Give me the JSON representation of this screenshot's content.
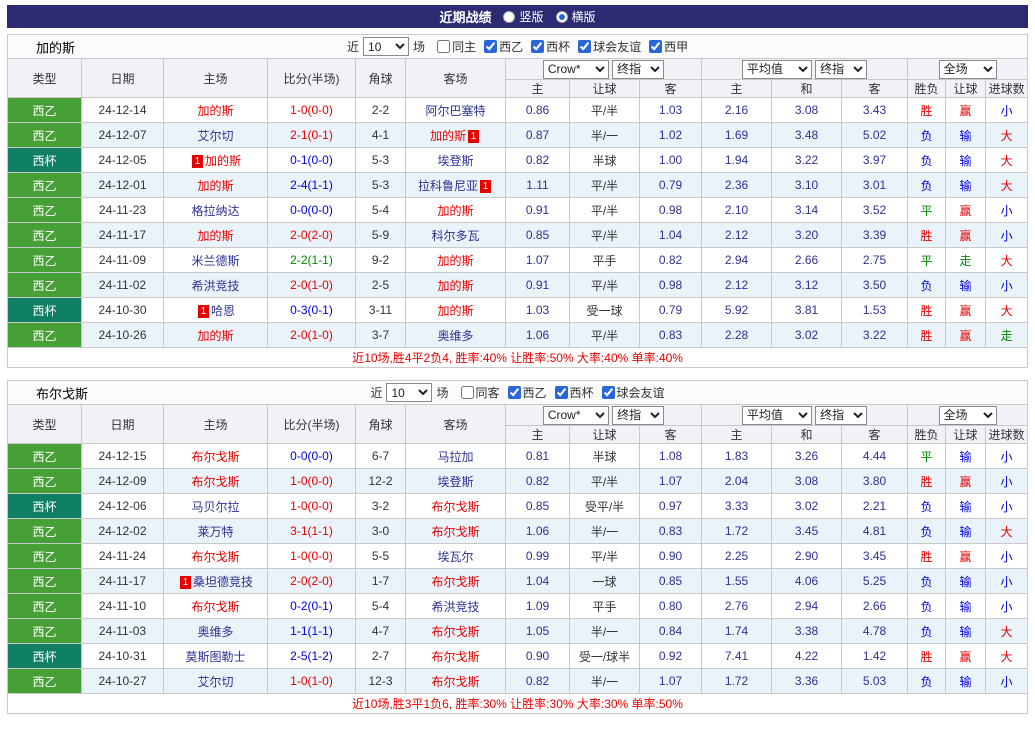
{
  "topbar": {
    "title": "近期战绩",
    "radios": [
      {
        "label": "竖版",
        "selected": false
      },
      {
        "label": "横版",
        "selected": true
      }
    ]
  },
  "table_header": {
    "left_cols": [
      "类型",
      "日期",
      "主场",
      "比分(半场)",
      "角球",
      "客场"
    ],
    "sub_cols": [
      "主",
      "让球",
      "客",
      "主",
      "和",
      "客",
      "胜负",
      "让球",
      "进球数"
    ],
    "select_odds_source": "Crow*",
    "select_final1": "终指",
    "select_avg": "平均值",
    "select_final2": "终指",
    "select_scope": "全场"
  },
  "colors": {
    "topbar_bg": "#2b2a72",
    "league_west2_green": "#47a035",
    "league_cup_teal": "#0e7f63",
    "tracked_team_red": "#e60000",
    "win_red": "#e60000",
    "loss_blue": "#0000dd",
    "push_green": "#008800",
    "alt_row_blue": "#eaf2fa"
  },
  "sections": [
    {
      "team": "加的斯",
      "filter_prefix": "近",
      "filter_count": "10",
      "filter_suffix": "场",
      "checkboxes": [
        {
          "label": "同主",
          "checked": false
        },
        {
          "label": "西乙",
          "checked": true
        },
        {
          "label": "西杯",
          "checked": true
        },
        {
          "label": "球会友谊",
          "checked": true
        },
        {
          "label": "西甲",
          "checked": true
        }
      ],
      "rows": [
        {
          "league": "西乙",
          "league_color": "green",
          "date": "24-12-14",
          "home": "加的斯",
          "home_tracked": true,
          "home_badge": "",
          "score": "1-0(0-0)",
          "score_color": "red",
          "corners": "2-2",
          "away": "阿尔巴塞特",
          "away_tracked": false,
          "away_badge": "",
          "o1": [
            "0.86",
            "平/半",
            "1.03"
          ],
          "o2": [
            "2.16",
            "3.08",
            "3.43"
          ],
          "r": [
            [
              "胜",
              "red"
            ],
            [
              "赢",
              "red"
            ],
            [
              "小",
              "blue"
            ]
          ]
        },
        {
          "league": "西乙",
          "league_color": "green",
          "date": "24-12-07",
          "home": "艾尔切",
          "home_tracked": false,
          "home_badge": "",
          "score": "2-1(0-1)",
          "score_color": "red",
          "corners": "4-1",
          "away": "加的斯",
          "away_tracked": true,
          "away_badge": "1",
          "o1": [
            "0.87",
            "半/一",
            "1.02"
          ],
          "o2": [
            "1.69",
            "3.48",
            "5.02"
          ],
          "r": [
            [
              "负",
              "blue"
            ],
            [
              "输",
              "blue"
            ],
            [
              "大",
              "red"
            ]
          ]
        },
        {
          "league": "西杯",
          "league_color": "teal",
          "date": "24-12-05",
          "home": "加的斯",
          "home_tracked": true,
          "home_badge": "1",
          "score": "0-1(0-0)",
          "score_color": "blue",
          "corners": "5-3",
          "away": "埃登斯",
          "away_tracked": false,
          "away_badge": "",
          "o1": [
            "0.82",
            "半球",
            "1.00"
          ],
          "o2": [
            "1.94",
            "3.22",
            "3.97"
          ],
          "r": [
            [
              "负",
              "blue"
            ],
            [
              "输",
              "blue"
            ],
            [
              "大",
              "red"
            ]
          ]
        },
        {
          "league": "西乙",
          "league_color": "green",
          "date": "24-12-01",
          "home": "加的斯",
          "home_tracked": true,
          "home_badge": "",
          "score": "2-4(1-1)",
          "score_color": "blue",
          "corners": "5-3",
          "away": "拉科鲁尼亚",
          "away_tracked": false,
          "away_badge": "1",
          "o1": [
            "1.11",
            "平/半",
            "0.79"
          ],
          "o2": [
            "2.36",
            "3.10",
            "3.01"
          ],
          "r": [
            [
              "负",
              "blue"
            ],
            [
              "输",
              "blue"
            ],
            [
              "大",
              "red"
            ]
          ]
        },
        {
          "league": "西乙",
          "league_color": "green",
          "date": "24-11-23",
          "home": "格拉纳达",
          "home_tracked": false,
          "home_badge": "",
          "score": "0-0(0-0)",
          "score_color": "blue",
          "corners": "5-4",
          "away": "加的斯",
          "away_tracked": true,
          "away_badge": "",
          "o1": [
            "0.91",
            "平/半",
            "0.98"
          ],
          "o2": [
            "2.10",
            "3.14",
            "3.52"
          ],
          "r": [
            [
              "平",
              "green"
            ],
            [
              "赢",
              "red"
            ],
            [
              "小",
              "blue"
            ]
          ]
        },
        {
          "league": "西乙",
          "league_color": "green",
          "date": "24-11-17",
          "home": "加的斯",
          "home_tracked": true,
          "home_badge": "",
          "score": "2-0(2-0)",
          "score_color": "red",
          "corners": "5-9",
          "away": "科尔多瓦",
          "away_tracked": false,
          "away_badge": "",
          "o1": [
            "0.85",
            "平/半",
            "1.04"
          ],
          "o2": [
            "2.12",
            "3.20",
            "3.39"
          ],
          "r": [
            [
              "胜",
              "red"
            ],
            [
              "赢",
              "red"
            ],
            [
              "小",
              "blue"
            ]
          ]
        },
        {
          "league": "西乙",
          "league_color": "green",
          "date": "24-11-09",
          "home": "米兰德斯",
          "home_tracked": false,
          "home_badge": "",
          "score": "2-2(1-1)",
          "score_color": "green",
          "corners": "9-2",
          "away": "加的斯",
          "away_tracked": true,
          "away_badge": "",
          "o1": [
            "1.07",
            "平手",
            "0.82"
          ],
          "o2": [
            "2.94",
            "2.66",
            "2.75"
          ],
          "r": [
            [
              "平",
              "green"
            ],
            [
              "走",
              "green"
            ],
            [
              "大",
              "red"
            ]
          ]
        },
        {
          "league": "西乙",
          "league_color": "green",
          "date": "24-11-02",
          "home": "希洪竞技",
          "home_tracked": false,
          "home_badge": "",
          "score": "2-0(1-0)",
          "score_color": "red",
          "corners": "2-5",
          "away": "加的斯",
          "away_tracked": true,
          "away_badge": "",
          "o1": [
            "0.91",
            "平/半",
            "0.98"
          ],
          "o2": [
            "2.12",
            "3.12",
            "3.50"
          ],
          "r": [
            [
              "负",
              "blue"
            ],
            [
              "输",
              "blue"
            ],
            [
              "小",
              "blue"
            ]
          ]
        },
        {
          "league": "西杯",
          "league_color": "teal",
          "date": "24-10-30",
          "home": "哈恩",
          "home_tracked": false,
          "home_badge": "1",
          "score": "0-3(0-1)",
          "score_color": "blue",
          "corners": "3-11",
          "away": "加的斯",
          "away_tracked": true,
          "away_badge": "",
          "o1": [
            "1.03",
            "受一球",
            "0.79"
          ],
          "o2": [
            "5.92",
            "3.81",
            "1.53"
          ],
          "r": [
            [
              "胜",
              "red"
            ],
            [
              "赢",
              "red"
            ],
            [
              "大",
              "red"
            ]
          ]
        },
        {
          "league": "西乙",
          "league_color": "green",
          "date": "24-10-26",
          "home": "加的斯",
          "home_tracked": true,
          "home_badge": "",
          "score": "2-0(1-0)",
          "score_color": "red",
          "corners": "3-7",
          "away": "奥维多",
          "away_tracked": false,
          "away_badge": "",
          "o1": [
            "1.06",
            "平/半",
            "0.83"
          ],
          "o2": [
            "2.28",
            "3.02",
            "3.22"
          ],
          "r": [
            [
              "胜",
              "red"
            ],
            [
              "赢",
              "red"
            ],
            [
              "走",
              "green"
            ]
          ]
        }
      ],
      "summary": "近10场,胜4平2负4, 胜率:40% 让胜率:50% 大率:40% 单率:40%"
    },
    {
      "team": "布尔戈斯",
      "filter_prefix": "近",
      "filter_count": "10",
      "filter_suffix": "场",
      "checkboxes": [
        {
          "label": "同客",
          "checked": false
        },
        {
          "label": "西乙",
          "checked": true
        },
        {
          "label": "西杯",
          "checked": true
        },
        {
          "label": "球会友谊",
          "checked": true
        }
      ],
      "rows": [
        {
          "league": "西乙",
          "league_color": "green",
          "date": "24-12-15",
          "home": "布尔戈斯",
          "home_tracked": true,
          "home_badge": "",
          "score": "0-0(0-0)",
          "score_color": "blue",
          "corners": "6-7",
          "away": "马拉加",
          "away_tracked": false,
          "away_badge": "",
          "o1": [
            "0.81",
            "半球",
            "1.08"
          ],
          "o2": [
            "1.83",
            "3.26",
            "4.44"
          ],
          "r": [
            [
              "平",
              "green"
            ],
            [
              "输",
              "blue"
            ],
            [
              "小",
              "blue"
            ]
          ]
        },
        {
          "league": "西乙",
          "league_color": "green",
          "date": "24-12-09",
          "home": "布尔戈斯",
          "home_tracked": true,
          "home_badge": "",
          "score": "1-0(0-0)",
          "score_color": "red",
          "corners": "12-2",
          "away": "埃登斯",
          "away_tracked": false,
          "away_badge": "",
          "o1": [
            "0.82",
            "平/半",
            "1.07"
          ],
          "o2": [
            "2.04",
            "3.08",
            "3.80"
          ],
          "r": [
            [
              "胜",
              "red"
            ],
            [
              "赢",
              "red"
            ],
            [
              "小",
              "blue"
            ]
          ]
        },
        {
          "league": "西杯",
          "league_color": "teal",
          "date": "24-12-06",
          "home": "马贝尔拉",
          "home_tracked": false,
          "home_badge": "",
          "score": "1-0(0-0)",
          "score_color": "red",
          "corners": "3-2",
          "away": "布尔戈斯",
          "away_tracked": true,
          "away_badge": "",
          "o1": [
            "0.85",
            "受平/半",
            "0.97"
          ],
          "o2": [
            "3.33",
            "3.02",
            "2.21"
          ],
          "r": [
            [
              "负",
              "blue"
            ],
            [
              "输",
              "blue"
            ],
            [
              "小",
              "blue"
            ]
          ]
        },
        {
          "league": "西乙",
          "league_color": "green",
          "date": "24-12-02",
          "home": "莱万特",
          "home_tracked": false,
          "home_badge": "",
          "score": "3-1(1-1)",
          "score_color": "red",
          "corners": "3-0",
          "away": "布尔戈斯",
          "away_tracked": true,
          "away_badge": "",
          "o1": [
            "1.06",
            "半/一",
            "0.83"
          ],
          "o2": [
            "1.72",
            "3.45",
            "4.81"
          ],
          "r": [
            [
              "负",
              "blue"
            ],
            [
              "输",
              "blue"
            ],
            [
              "大",
              "red"
            ]
          ]
        },
        {
          "league": "西乙",
          "league_color": "green",
          "date": "24-11-24",
          "home": "布尔戈斯",
          "home_tracked": true,
          "home_badge": "",
          "score": "1-0(0-0)",
          "score_color": "red",
          "corners": "5-5",
          "away": "埃瓦尔",
          "away_tracked": false,
          "away_badge": "",
          "o1": [
            "0.99",
            "平/半",
            "0.90"
          ],
          "o2": [
            "2.25",
            "2.90",
            "3.45"
          ],
          "r": [
            [
              "胜",
              "red"
            ],
            [
              "赢",
              "red"
            ],
            [
              "小",
              "blue"
            ]
          ]
        },
        {
          "league": "西乙",
          "league_color": "green",
          "date": "24-11-17",
          "home": "桑坦德竞技",
          "home_tracked": false,
          "home_badge": "1",
          "score": "2-0(2-0)",
          "score_color": "red",
          "corners": "1-7",
          "away": "布尔戈斯",
          "away_tracked": true,
          "away_badge": "",
          "o1": [
            "1.04",
            "一球",
            "0.85"
          ],
          "o2": [
            "1.55",
            "4.06",
            "5.25"
          ],
          "r": [
            [
              "负",
              "blue"
            ],
            [
              "输",
              "blue"
            ],
            [
              "小",
              "blue"
            ]
          ]
        },
        {
          "league": "西乙",
          "league_color": "green",
          "date": "24-11-10",
          "home": "布尔戈斯",
          "home_tracked": true,
          "home_badge": "",
          "score": "0-2(0-1)",
          "score_color": "blue",
          "corners": "5-4",
          "away": "希洪竞技",
          "away_tracked": false,
          "away_badge": "",
          "o1": [
            "1.09",
            "平手",
            "0.80"
          ],
          "o2": [
            "2.76",
            "2.94",
            "2.66"
          ],
          "r": [
            [
              "负",
              "blue"
            ],
            [
              "输",
              "blue"
            ],
            [
              "小",
              "blue"
            ]
          ]
        },
        {
          "league": "西乙",
          "league_color": "green",
          "date": "24-11-03",
          "home": "奥维多",
          "home_tracked": false,
          "home_badge": "",
          "score": "1-1(1-1)",
          "score_color": "blue",
          "corners": "4-7",
          "away": "布尔戈斯",
          "away_tracked": true,
          "away_badge": "",
          "o1": [
            "1.05",
            "半/一",
            "0.84"
          ],
          "o2": [
            "1.74",
            "3.38",
            "4.78"
          ],
          "r": [
            [
              "负",
              "blue"
            ],
            [
              "输",
              "blue"
            ],
            [
              "大",
              "red"
            ]
          ]
        },
        {
          "league": "西杯",
          "league_color": "teal",
          "date": "24-10-31",
          "home": "莫斯图勒士",
          "home_tracked": false,
          "home_badge": "",
          "score": "2-5(1-2)",
          "score_color": "blue",
          "corners": "2-7",
          "away": "布尔戈斯",
          "away_tracked": true,
          "away_badge": "",
          "o1": [
            "0.90",
            "受一/球半",
            "0.92"
          ],
          "o2": [
            "7.41",
            "4.22",
            "1.42"
          ],
          "r": [
            [
              "胜",
              "red"
            ],
            [
              "赢",
              "red"
            ],
            [
              "大",
              "red"
            ]
          ]
        },
        {
          "league": "西乙",
          "league_color": "green",
          "date": "24-10-27",
          "home": "艾尔切",
          "home_tracked": false,
          "home_badge": "",
          "score": "1-0(1-0)",
          "score_color": "red",
          "corners": "12-3",
          "away": "布尔戈斯",
          "away_tracked": true,
          "away_badge": "",
          "o1": [
            "0.82",
            "半/一",
            "1.07"
          ],
          "o2": [
            "1.72",
            "3.36",
            "5.03"
          ],
          "r": [
            [
              "负",
              "blue"
            ],
            [
              "输",
              "blue"
            ],
            [
              "小",
              "blue"
            ]
          ]
        }
      ],
      "summary": "近10场,胜3平1负6, 胜率:30% 让胜率:30% 大率:30% 单率:50%"
    }
  ]
}
